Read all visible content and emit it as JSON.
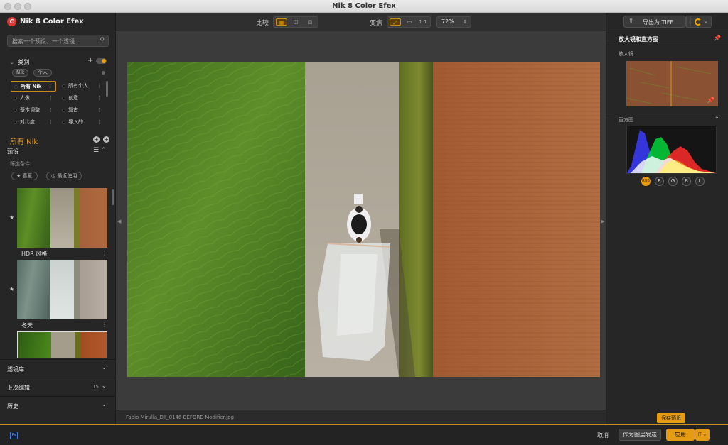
{
  "window": {
    "title": "Nik 8 Color Efex"
  },
  "sidebar": {
    "app_name": "Nik 8 Color Efex",
    "logo_letter": "C",
    "search_placeholder": "搜索一个预设、一个滤镜...",
    "categories": {
      "heading": "类别",
      "chips": [
        "Nik",
        "个人"
      ],
      "items": [
        {
          "label": "所有 Nik",
          "selected": true
        },
        {
          "label": "所有个人",
          "selected": false
        },
        {
          "label": "人像",
          "selected": false
        },
        {
          "label": "创意",
          "selected": false
        },
        {
          "label": "基本调整",
          "selected": false
        },
        {
          "label": "复古",
          "selected": false
        },
        {
          "label": "对比度",
          "selected": false
        },
        {
          "label": "导入的",
          "selected": false
        }
      ]
    },
    "collection_title": "所有 Nik",
    "presets": {
      "heading": "预设",
      "filter_label": "筛选条件:",
      "filter_pills": [
        "★ 喜爱",
        "◷ 最近使用"
      ],
      "items": [
        {
          "label": "HDR 风格",
          "style": "color"
        },
        {
          "label": "冬天",
          "style": "desat"
        }
      ]
    },
    "accordions": [
      {
        "label": "滤镜库",
        "count": ""
      },
      {
        "label": "上次编辑",
        "count": "15"
      },
      {
        "label": "历史",
        "count": ""
      }
    ]
  },
  "toolbar": {
    "compare_label": "比较",
    "transform_label": "变焦",
    "one_to_one": "1:1",
    "zoom_value": "72%"
  },
  "canvas": {
    "filename": "Fabio Mirulla_DJI_0146-BEFORE-Modifier.jpg"
  },
  "right_panel": {
    "export_label": "导出为 TIFF",
    "section_title": "放大镜和直方图",
    "magnifier_label": "放大镜",
    "histogram_label": "直方图",
    "histogram_channels": [
      "RGB",
      "R",
      "G",
      "B",
      "L"
    ],
    "histogram_active": "RGB",
    "save_preset": "保存预设"
  },
  "footer": {
    "ps_label": "Ps",
    "cancel": "取消",
    "send_as_layer": "作为图层发送",
    "apply": "应用"
  },
  "colors": {
    "accent": "#e69c12",
    "brand": "#d83a35"
  }
}
